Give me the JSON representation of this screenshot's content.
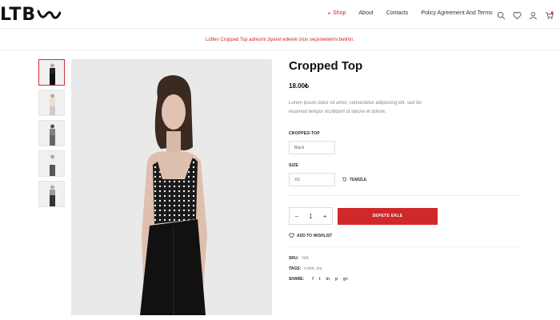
{
  "header": {
    "logo": "LTB",
    "nav": [
      {
        "label": "Shop",
        "active": true
      },
      {
        "label": "About",
        "active": false
      },
      {
        "label": "Contacts",
        "active": false
      },
      {
        "label": "Policy Agreement And Terms",
        "active": false
      }
    ],
    "icons": [
      "search-icon",
      "heart-icon",
      "user-icon",
      "cart-icon"
    ]
  },
  "notice": "Lütfen Cropped Top adresini ziyaret ederek ürün seçeneklerini belirtin.",
  "product": {
    "title": "Cropped Top",
    "price": "18.00₺",
    "description": "Lorem ipsum dolor sit amet, consectetur adipiscing elit, sed do eiusmod tempor incididunt ut labore et dolore.",
    "option_label": "CROPPED-TOP",
    "option_value": "Black",
    "size_label": "SIZE",
    "size_value": "XS",
    "clear_label": "TEMİZLE",
    "quantity": "1",
    "add_to_cart": "SEPETE EKLE",
    "wishlist": "ADD TO WISHLIST",
    "sku_label": "SKU:",
    "sku_value": "N/A",
    "tags_label": "TAGS:",
    "tags_value": "t-shirt, top",
    "share_label": "SHARE:",
    "share_icons": [
      "f",
      "t",
      "in",
      "p",
      "g+"
    ]
  },
  "colors": {
    "accent": "#d0282b"
  }
}
